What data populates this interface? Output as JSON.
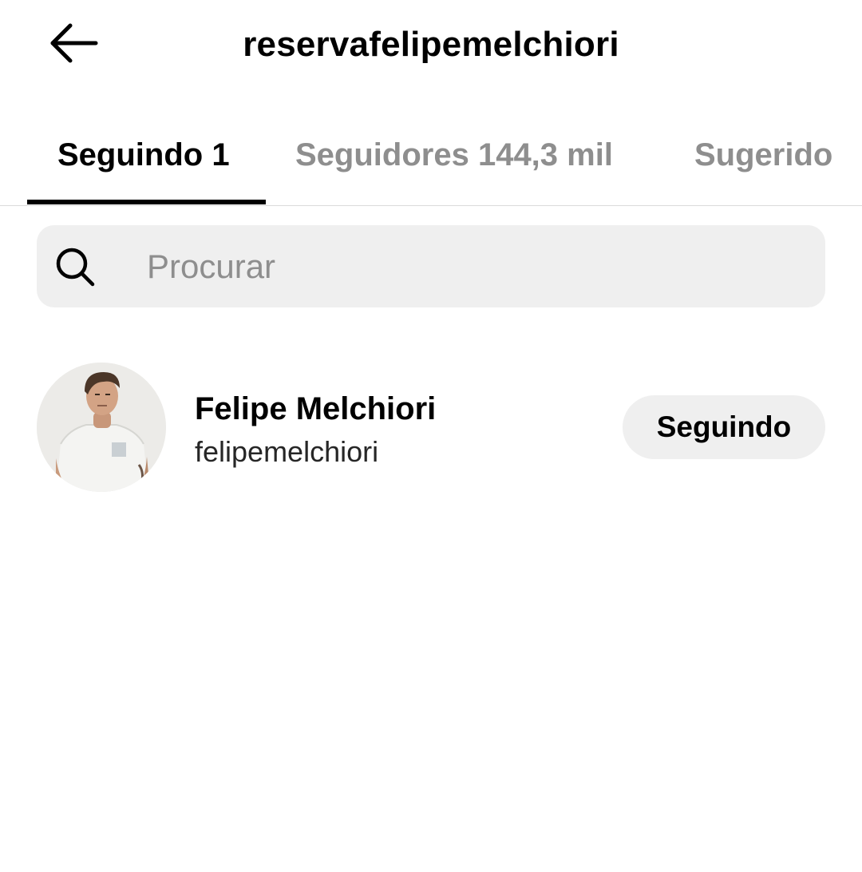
{
  "header": {
    "back_icon": "arrow-left-icon",
    "title": "reservafelipemelchiori"
  },
  "tabs": [
    {
      "label": "Seguindo 1",
      "active": true
    },
    {
      "label": "Seguidores 144,3 mil",
      "active": false
    },
    {
      "label": "Sugerido",
      "active": false
    }
  ],
  "search": {
    "icon": "search-icon",
    "placeholder": "Procurar",
    "value": ""
  },
  "following_list": [
    {
      "display_name": "Felipe Melchiori",
      "username": "felipemelchiori",
      "avatar": "profile-photo",
      "button_label": "Seguindo"
    }
  ],
  "colors": {
    "text_primary": "#000000",
    "text_secondary": "#8e8e8e",
    "surface_gray": "#efefef",
    "divider": "#dbdbdb"
  }
}
